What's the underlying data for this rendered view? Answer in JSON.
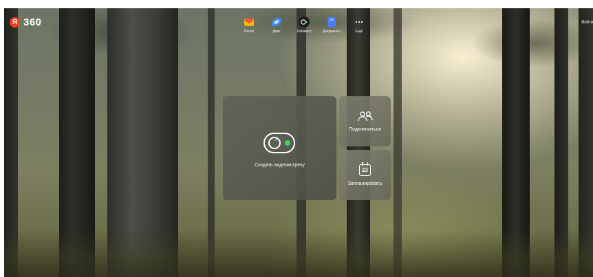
{
  "brand": {
    "logo_letter": "Я",
    "logo_text": "360",
    "logo_color": "#fc3f1d"
  },
  "apps": [
    {
      "label": "Почта",
      "icon": "mail-icon"
    },
    {
      "label": "Диск",
      "icon": "disk-icon"
    },
    {
      "label": "Телемост",
      "icon": "telemost-icon"
    },
    {
      "label": "Документы",
      "icon": "documents-icon"
    },
    {
      "label": "Ещё",
      "icon": "more-icon"
    }
  ],
  "header": {
    "login_label": "Войти"
  },
  "actions": {
    "create_meeting": {
      "label": "Создать видеовстречу",
      "icon": "video-camera-icon",
      "indicator_color": "#44d062"
    },
    "join": {
      "label": "Подключиться",
      "icon": "people-icon"
    },
    "schedule": {
      "label": "Запланировать",
      "icon": "calendar-icon",
      "calendar_day": "23"
    }
  }
}
